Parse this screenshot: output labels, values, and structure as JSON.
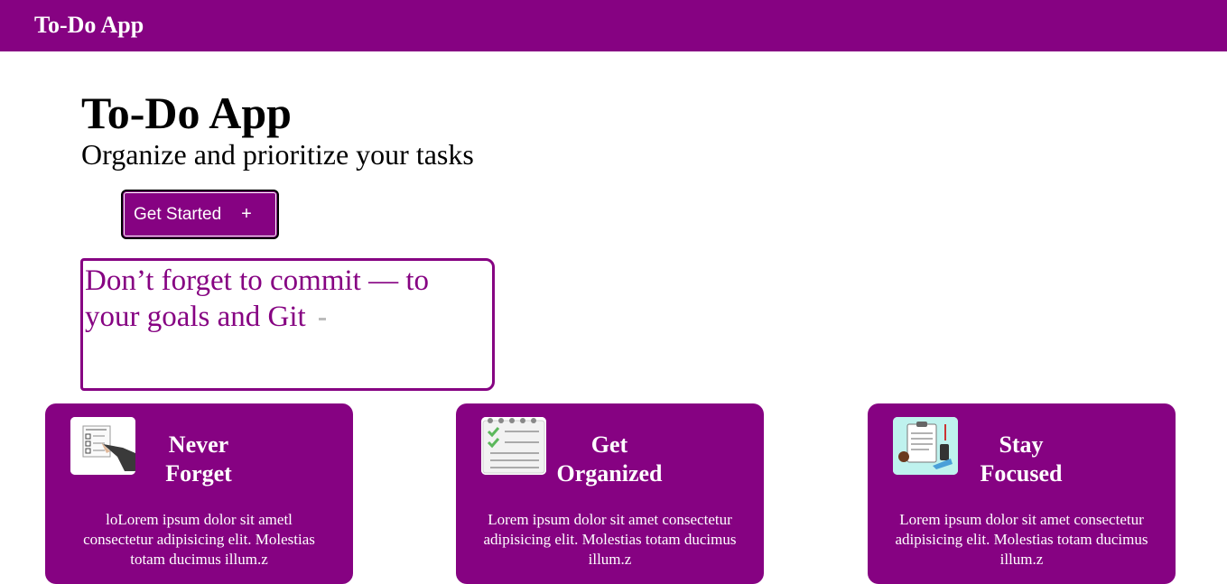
{
  "navbar": {
    "brand": "To-Do App"
  },
  "hero": {
    "title": "To-Do App",
    "subtitle": "Organize and prioritize your tasks",
    "cta_label": "Get Started",
    "cta_icon": "plus-icon",
    "cta_symbol": "+"
  },
  "quote": {
    "text": "Don’t forget to commit — to your goals and Git"
  },
  "colors": {
    "accent": "#860282",
    "text_light": "#ffffff"
  },
  "features": [
    {
      "icon": "checklist-icon",
      "title": "Never Forget",
      "text": "loLorem ipsum dolor sit ametl consectetur adipisicing elit. Molestias totam ducimus illum.z"
    },
    {
      "icon": "notepad-icon",
      "title": "Get Organized",
      "text": "Lorem ipsum dolor sit amet consectetur adipisicing elit. Molestias totam ducimus illum.z"
    },
    {
      "icon": "clipboard-icon",
      "title": "Stay Focused",
      "text": "Lorem ipsum dolor sit amet consectetur adipisicing elit. Molestias totam ducimus illum.z"
    }
  ]
}
